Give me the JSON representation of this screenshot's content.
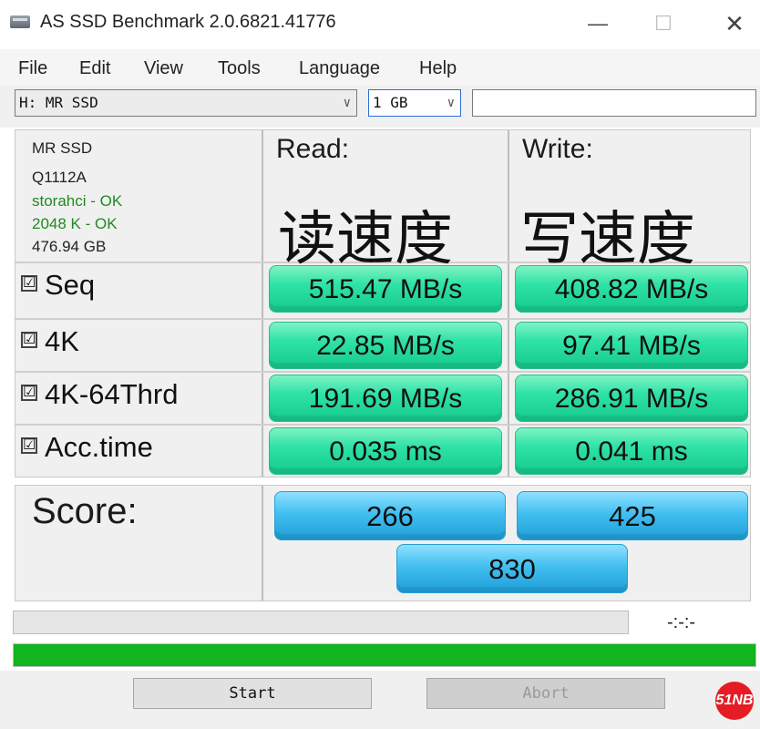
{
  "window": {
    "title": "AS SSD Benchmark 2.0.6821.41776",
    "min_glyph": "—",
    "max_glyph": "☐",
    "close_glyph": "✕"
  },
  "menu": [
    "File",
    "Edit",
    "View",
    "Tools",
    "Language",
    "Help"
  ],
  "toolbar": {
    "drive": "H: MR SSD",
    "size": "1 GB",
    "arrow": "∨",
    "text": ""
  },
  "drive_info": {
    "name": "MR SSD",
    "model": "Q1112A",
    "driver": "storahci - OK",
    "alignment": "2048 K - OK",
    "capacity": "476.94 GB"
  },
  "columns": {
    "read": "Read:",
    "write": "Write:",
    "read_cn": "读速度",
    "write_cn": "写速度"
  },
  "tests": [
    {
      "label": "Seq",
      "checked": "☑",
      "read": "515.47 MB/s",
      "write": "408.82 MB/s"
    },
    {
      "label": "4K",
      "checked": "☑",
      "read": "22.85 MB/s",
      "write": "97.41 MB/s"
    },
    {
      "label": "4K-64Thrd",
      "checked": "☑",
      "read": "191.69 MB/s",
      "write": "286.91 MB/s"
    },
    {
      "label": "Acc.time",
      "checked": "☑",
      "read": "0.035 ms",
      "write": "0.041 ms"
    }
  ],
  "score": {
    "label": "Score:",
    "read": "266",
    "write": "425",
    "total": "830"
  },
  "progress": {
    "timer": "-:-:-",
    "total_fraction": 1.0
  },
  "buttons": {
    "start": "Start",
    "abort": "Abort"
  },
  "watermark": "51NB",
  "colors": {
    "result_green": "#2fe2a6",
    "score_blue": "#42bff0",
    "progress_green": "#11b51d"
  }
}
